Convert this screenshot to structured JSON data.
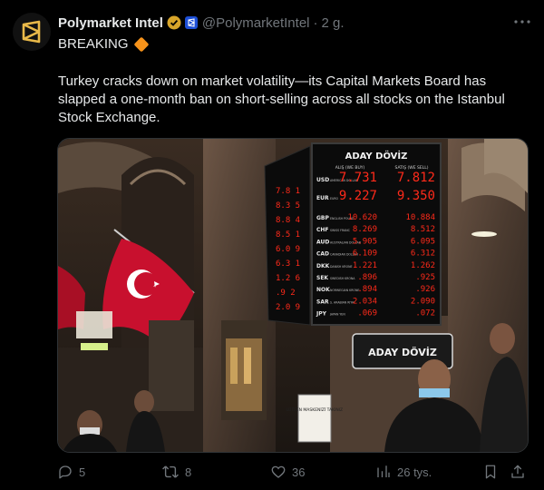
{
  "post": {
    "author_name": "Polymarket Intel",
    "handle": "@PolymarketIntel",
    "separator": "·",
    "time": "2 g.",
    "headline": "BREAKING",
    "text": "Turkey cracks down on market volatility—its Capital Markets Board has slapped a one-month ban on short-selling across all stocks on the Istanbul Stock Exchange."
  },
  "media": {
    "board_brand": "ADAY DÖVİZ",
    "board_col_buy": "ALIŞ (WE BUY)",
    "board_col_sell": "SATIŞ (WE SELL)",
    "board_rows": [
      {
        "code": "USD",
        "name": "AMERICAN DOLLAR",
        "buy": "7.731",
        "sell": "7.812"
      },
      {
        "code": "EUR",
        "name": "EURO",
        "buy": "9.227",
        "sell": "9.350"
      },
      {
        "code": "GBP",
        "name": "ENGLISH POUND",
        "buy": "10.620",
        "sell": "10.884"
      },
      {
        "code": "CHF",
        "name": "SWISS FRANC",
        "buy": "8.269",
        "sell": "8.512"
      },
      {
        "code": "AUD",
        "name": "AUSTRALIAN DOLLAR",
        "buy": "5.905",
        "sell": "6.095"
      },
      {
        "code": "CAD",
        "name": "CANADIAN DOLLAR",
        "buy": "6.109",
        "sell": "6.312"
      },
      {
        "code": "DKK",
        "name": "DANISH KRONE",
        "buy": "1.221",
        "sell": "1.262"
      },
      {
        "code": "SEK",
        "name": "SWEDISH KRONA",
        "buy": ".896",
        "sell": ".925"
      },
      {
        "code": "NOK",
        "name": "NORWEGIAN KRONE",
        "buy": ".894",
        "sell": ".926"
      },
      {
        "code": "SAR",
        "name": "S. ARABIAN RIYAL",
        "buy": "2.034",
        "sell": "2.090"
      },
      {
        "code": "JPY",
        "name": "JAPAN YEN",
        "buy": ".069",
        "sell": ".072"
      }
    ],
    "sign_brand": "ADAY DÖVİZ",
    "notice_sign": "LÜTFEN MASKENİZİ TAKINIZ",
    "colors": {
      "board": "#0b0b0b",
      "led": "#ff2a1a",
      "flag": "#c8102e"
    }
  },
  "actions": {
    "replies": "5",
    "reposts": "8",
    "likes": "36",
    "views": "26 tys."
  },
  "icons": [
    "polymarket-logo-icon",
    "verified-badge-icon",
    "affiliate-badge-icon",
    "more-icon",
    "diamond-icon",
    "reply-icon",
    "repost-icon",
    "like-icon",
    "views-icon",
    "bookmark-icon",
    "share-icon"
  ],
  "colors": {
    "background": "#000000",
    "text": "#e7e9ea",
    "muted": "#71767b",
    "verified": "#d8a52a",
    "affiliate": "#1d4fd6",
    "accent_diamond": "#f7931a"
  }
}
